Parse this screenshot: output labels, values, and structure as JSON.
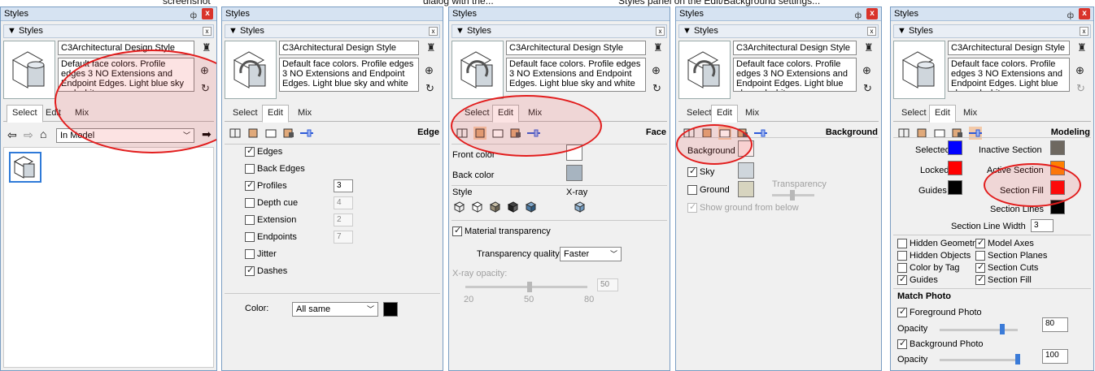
{
  "caption_fragments": [
    "screenshot",
    "dialog with the...",
    "Styles panel on the Edit/Background settings..."
  ],
  "panel_title": "Styles",
  "section_title": "Styles",
  "style_name": "C3Architectural Design Style",
  "style_desc_1": "Default face colors. Profile edges 3 NO Extensions and Endpoint Edges. Light blue sky and white",
  "tabs": [
    "Select",
    "Edit",
    "Mix"
  ],
  "p1": {
    "collection": "In Model"
  },
  "p2": {
    "heading": "Edge",
    "items": [
      {
        "label": "Edges",
        "checked": true,
        "value": ""
      },
      {
        "label": "Back Edges",
        "checked": false,
        "value": ""
      },
      {
        "label": "Profiles",
        "checked": true,
        "value": "3"
      },
      {
        "label": "Depth cue",
        "checked": false,
        "value": "4"
      },
      {
        "label": "Extension",
        "checked": false,
        "value": "2"
      },
      {
        "label": "Endpoints",
        "checked": false,
        "value": "7"
      },
      {
        "label": "Jitter",
        "checked": false,
        "value": ""
      },
      {
        "label": "Dashes",
        "checked": true,
        "value": ""
      }
    ],
    "color_label": "Color:",
    "color_value": "All same"
  },
  "p3": {
    "heading": "Face",
    "front": "Front color",
    "back": "Back color",
    "style": "Style",
    "xray": "X-ray",
    "material": "Material transparency",
    "tq_label": "Transparency quality:",
    "tq_value": "Faster",
    "xray_opacity": "X-ray opacity:",
    "xray_val": "50",
    "ticks": [
      "20",
      "50",
      "80"
    ]
  },
  "p4": {
    "heading": "Background",
    "background": "Background",
    "sky": "Sky",
    "ground": "Ground",
    "transparency": "Transparency",
    "show_ground": "Show ground from below"
  },
  "p5": {
    "heading": "Modeling",
    "selected": "Selected",
    "locked": "Locked",
    "guides": "Guides",
    "inactive": "Inactive Section",
    "active": "Active Section",
    "fill": "Section Fill",
    "lines": "Section Lines",
    "width_label": "Section Line Width",
    "width_val": "3",
    "left_cbs": [
      {
        "label": "Hidden Geometry",
        "checked": false
      },
      {
        "label": "Hidden Objects",
        "checked": false
      },
      {
        "label": "Color by Tag",
        "checked": false
      },
      {
        "label": "Guides",
        "checked": true
      }
    ],
    "right_cbs": [
      {
        "label": "Model Axes",
        "checked": true
      },
      {
        "label": "Section Planes",
        "checked": false
      },
      {
        "label": "Section Cuts",
        "checked": true
      },
      {
        "label": "Section Fill",
        "checked": true
      }
    ],
    "match_photo": "Match Photo",
    "fg_photo": "Foreground Photo",
    "bg_photo": "Background Photo",
    "opacity": "Opacity",
    "fg_val": "80",
    "bg_val": "100",
    "fg_level": 0.8,
    "bg_level": 1.0
  },
  "colors": {
    "front": "#ffffff",
    "back": "#a7b4c0",
    "background": "#fbeaea",
    "sky": "#cfd6dc",
    "ground": "#d7d4bf",
    "selected": "#0000ff",
    "locked": "#ff0000",
    "guides": "#000000",
    "inactive": "#6e6860",
    "active": "#ff8000",
    "fill": "#ff0000",
    "lines": "#000000"
  }
}
